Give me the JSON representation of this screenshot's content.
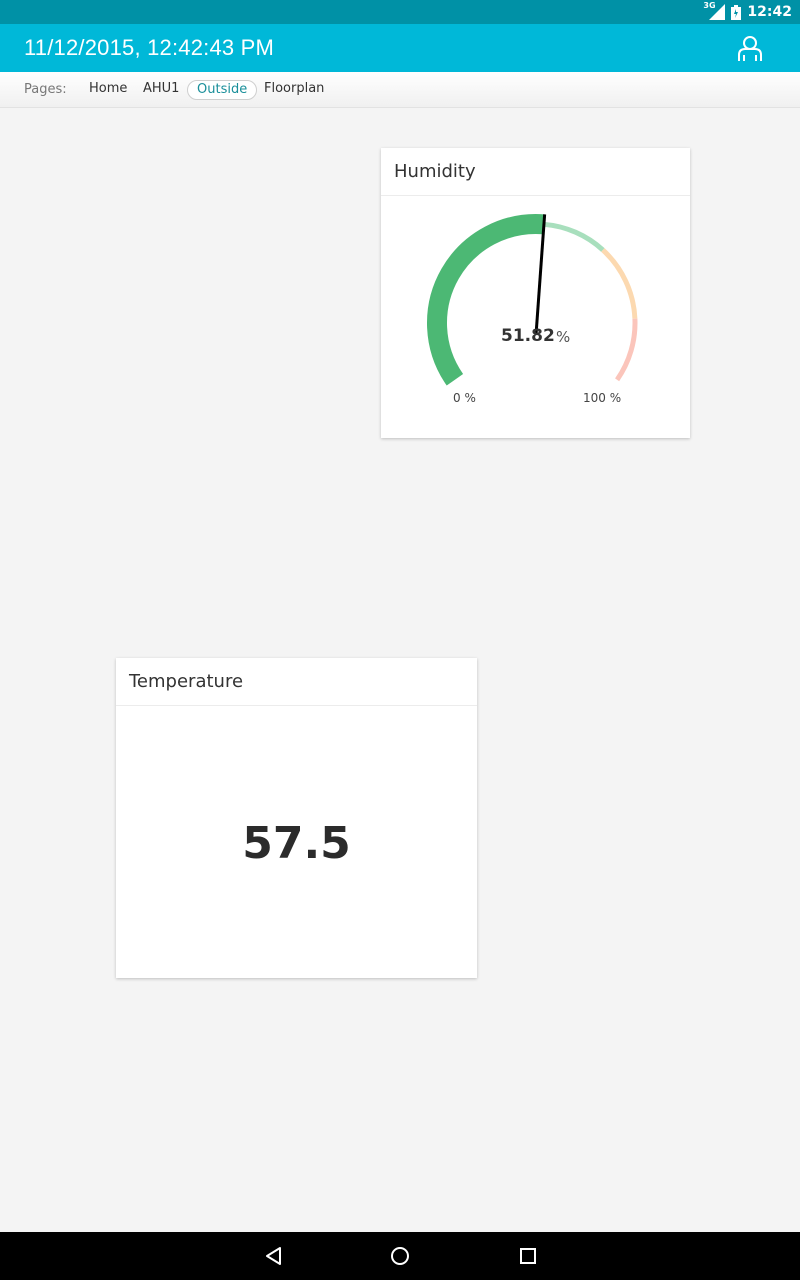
{
  "status_bar": {
    "network": "3G",
    "time": "12:42",
    "icons": [
      "signal-icon",
      "battery-icon"
    ]
  },
  "app_bar": {
    "title": "11/12/2015, 12:42:43 PM",
    "icon": "user-icon"
  },
  "pages_bar": {
    "label": "Pages:",
    "pages": [
      "Home",
      "AHU1",
      "Outside",
      "Floorplan"
    ],
    "active": "Outside"
  },
  "humidity": {
    "title": "Humidity",
    "value": "51.82",
    "unit": "%",
    "min_label": "0 %",
    "max_label": "100 %",
    "level": 51.82,
    "colors": {
      "filled": "#4cb874",
      "good": "#a8dfbd",
      "warn": "#fcd9b0",
      "bad": "#fbc5bb",
      "needle": "#000000"
    }
  },
  "temperature": {
    "title": "Temperature",
    "value": "57.5"
  },
  "nav_bar": {
    "icons": [
      "back-icon",
      "home-icon",
      "recents-icon"
    ]
  }
}
